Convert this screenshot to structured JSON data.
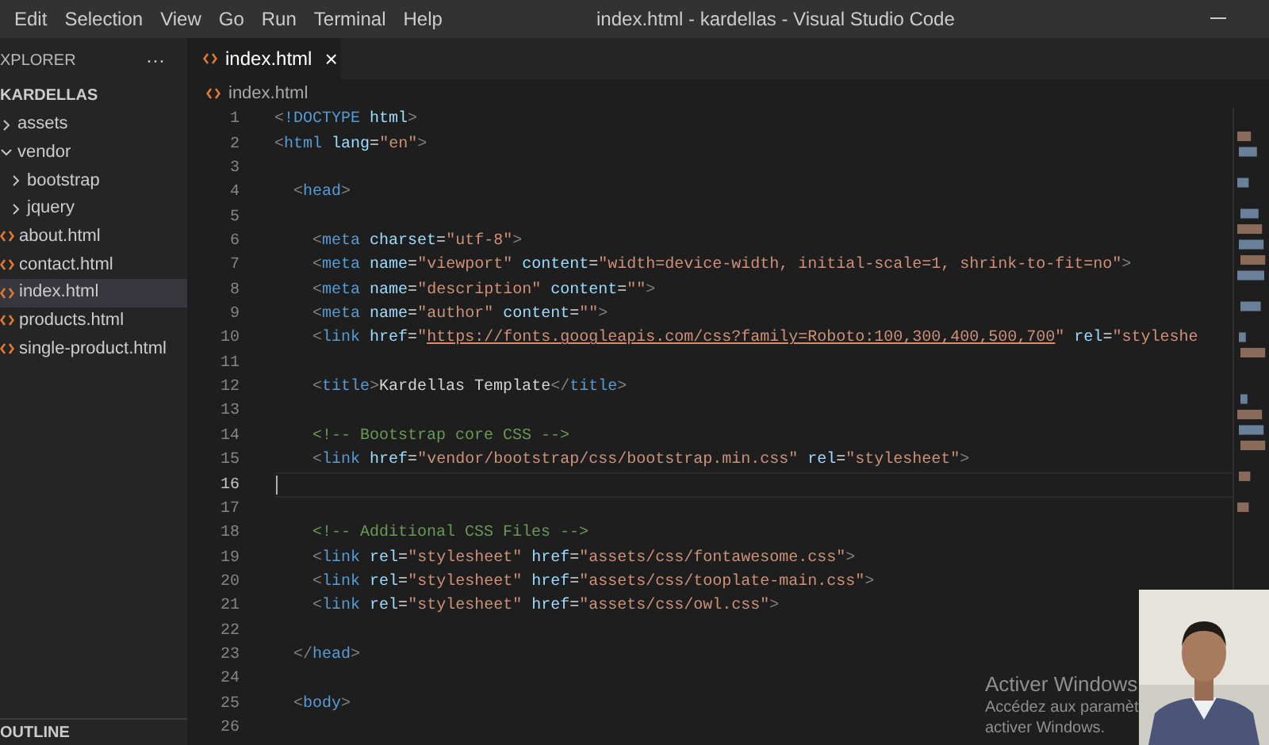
{
  "menu": [
    "Edit",
    "Selection",
    "View",
    "Go",
    "Run",
    "Terminal",
    "Help"
  ],
  "window": {
    "title": "index.html - kardellas - Visual Studio Code"
  },
  "sidebar": {
    "title": "XPLORER",
    "more": "···",
    "folder": "KARDELLAS",
    "items": [
      {
        "kind": "folder",
        "label": "assets",
        "expanded": false,
        "selected": false
      },
      {
        "kind": "folder",
        "label": "vendor",
        "expanded": true,
        "selected": false,
        "children": [
          {
            "kind": "folder",
            "label": "bootstrap",
            "expanded": false,
            "selected": false
          },
          {
            "kind": "folder",
            "label": "jquery",
            "expanded": false,
            "selected": false
          }
        ]
      },
      {
        "kind": "file",
        "label": "about.html",
        "selected": false
      },
      {
        "kind": "file",
        "label": "contact.html",
        "selected": false
      },
      {
        "kind": "file",
        "label": "index.html",
        "selected": true
      },
      {
        "kind": "file",
        "label": "products.html",
        "selected": false
      },
      {
        "kind": "file",
        "label": "single-product.html",
        "selected": false
      }
    ],
    "outline": "OUTLINE"
  },
  "tabs": [
    {
      "label": "index.html",
      "selected": true,
      "close": "×"
    }
  ],
  "breadcrumb": "index.html",
  "editor": {
    "lines": [
      {
        "number": "1",
        "current": false,
        "tokens": [
          {
            "kind": "p",
            "text": "<"
          },
          {
            "kind": "tag",
            "text": "!DOCTYPE"
          },
          {
            "kind": "attr",
            "text": " html"
          },
          {
            "kind": "p",
            "text": ">"
          }
        ]
      },
      {
        "number": "2",
        "current": false,
        "tokens": [
          {
            "kind": "p",
            "text": "<"
          },
          {
            "kind": "tag",
            "text": "html"
          },
          {
            "kind": "attr",
            "text": " lang"
          },
          {
            "kind": "text",
            "text": "="
          },
          {
            "kind": "str",
            "text": "\"en\""
          },
          {
            "kind": "p",
            "text": ">"
          }
        ]
      },
      {
        "number": "3",
        "current": false
      },
      {
        "number": "4",
        "current": false,
        "tokens": [
          {
            "kind": "p",
            "text": "  <"
          },
          {
            "kind": "tag",
            "text": "head"
          },
          {
            "kind": "p",
            "text": ">"
          }
        ]
      },
      {
        "number": "5",
        "current": false
      },
      {
        "number": "6",
        "current": false,
        "tokens": [
          {
            "kind": "p",
            "text": "    <"
          },
          {
            "kind": "tag",
            "text": "meta"
          },
          {
            "kind": "attr",
            "text": " charset"
          },
          {
            "kind": "text",
            "text": "="
          },
          {
            "kind": "str",
            "text": "\"utf-8\""
          },
          {
            "kind": "p",
            "text": ">"
          }
        ]
      },
      {
        "number": "7",
        "current": false,
        "tokens": [
          {
            "kind": "p",
            "text": "    <"
          },
          {
            "kind": "tag",
            "text": "meta"
          },
          {
            "kind": "attr",
            "text": " name"
          },
          {
            "kind": "text",
            "text": "="
          },
          {
            "kind": "str",
            "text": "\"viewport\""
          },
          {
            "kind": "attr",
            "text": " content"
          },
          {
            "kind": "text",
            "text": "="
          },
          {
            "kind": "str",
            "text": "\"width=device-width, initial-scale=1, shrink-to-fit=no\""
          },
          {
            "kind": "p",
            "text": ">"
          }
        ]
      },
      {
        "number": "8",
        "current": false,
        "tokens": [
          {
            "kind": "p",
            "text": "    <"
          },
          {
            "kind": "tag",
            "text": "meta"
          },
          {
            "kind": "attr",
            "text": " name"
          },
          {
            "kind": "text",
            "text": "="
          },
          {
            "kind": "str",
            "text": "\"description\""
          },
          {
            "kind": "attr",
            "text": " content"
          },
          {
            "kind": "text",
            "text": "="
          },
          {
            "kind": "str",
            "text": "\"\""
          },
          {
            "kind": "p",
            "text": ">"
          }
        ]
      },
      {
        "number": "9",
        "current": false,
        "tokens": [
          {
            "kind": "p",
            "text": "    <"
          },
          {
            "kind": "tag",
            "text": "meta"
          },
          {
            "kind": "attr",
            "text": " name"
          },
          {
            "kind": "text",
            "text": "="
          },
          {
            "kind": "str",
            "text": "\"author\""
          },
          {
            "kind": "attr",
            "text": " content"
          },
          {
            "kind": "text",
            "text": "="
          },
          {
            "kind": "str",
            "text": "\"\""
          },
          {
            "kind": "p",
            "text": ">"
          }
        ]
      },
      {
        "number": "10",
        "current": false,
        "tokens": [
          {
            "kind": "p",
            "text": "    <"
          },
          {
            "kind": "tag",
            "text": "link"
          },
          {
            "kind": "attr",
            "text": " href"
          },
          {
            "kind": "text",
            "text": "="
          },
          {
            "kind": "str",
            "text": "\""
          },
          {
            "kind": "url",
            "text": "https://fonts.googleapis.com/css?family=Roboto:100,300,400,500,700"
          },
          {
            "kind": "str",
            "text": "\""
          },
          {
            "kind": "attr",
            "text": " rel"
          },
          {
            "kind": "text",
            "text": "="
          },
          {
            "kind": "str",
            "text": "\"styleshe"
          }
        ]
      },
      {
        "number": "11",
        "current": false
      },
      {
        "number": "12",
        "current": false,
        "tokens": [
          {
            "kind": "p",
            "text": "    <"
          },
          {
            "kind": "tag",
            "text": "title"
          },
          {
            "kind": "p",
            "text": ">"
          },
          {
            "kind": "text",
            "text": "Kardellas Template"
          },
          {
            "kind": "p",
            "text": "</"
          },
          {
            "kind": "tag",
            "text": "title"
          },
          {
            "kind": "p",
            "text": ">"
          }
        ]
      },
      {
        "number": "13",
        "current": false
      },
      {
        "number": "14",
        "current": false,
        "tokens": [
          {
            "kind": "comment",
            "text": "    <!-- Bootstrap core CSS -->"
          }
        ]
      },
      {
        "number": "15",
        "current": false,
        "tokens": [
          {
            "kind": "p",
            "text": "    <"
          },
          {
            "kind": "tag",
            "text": "link"
          },
          {
            "kind": "attr",
            "text": " href"
          },
          {
            "kind": "text",
            "text": "="
          },
          {
            "kind": "str",
            "text": "\"vendor/bootstrap/css/bootstrap.min.css\""
          },
          {
            "kind": "attr",
            "text": " rel"
          },
          {
            "kind": "text",
            "text": "="
          },
          {
            "kind": "str",
            "text": "\"stylesheet\""
          },
          {
            "kind": "p",
            "text": ">"
          }
        ]
      },
      {
        "number": "16",
        "current": true
      },
      {
        "number": "17",
        "current": false
      },
      {
        "number": "18",
        "current": false,
        "tokens": [
          {
            "kind": "comment",
            "text": "    <!-- Additional CSS Files -->"
          }
        ]
      },
      {
        "number": "19",
        "current": false,
        "tokens": [
          {
            "kind": "p",
            "text": "    <"
          },
          {
            "kind": "tag",
            "text": "link"
          },
          {
            "kind": "attr",
            "text": " rel"
          },
          {
            "kind": "text",
            "text": "="
          },
          {
            "kind": "str",
            "text": "\"stylesheet\""
          },
          {
            "kind": "attr",
            "text": " href"
          },
          {
            "kind": "text",
            "text": "="
          },
          {
            "kind": "str",
            "text": "\"assets/css/fontawesome.css\""
          },
          {
            "kind": "p",
            "text": ">"
          }
        ]
      },
      {
        "number": "20",
        "current": false,
        "tokens": [
          {
            "kind": "p",
            "text": "    <"
          },
          {
            "kind": "tag",
            "text": "link"
          },
          {
            "kind": "attr",
            "text": " rel"
          },
          {
            "kind": "text",
            "text": "="
          },
          {
            "kind": "str",
            "text": "\"stylesheet\""
          },
          {
            "kind": "attr",
            "text": " href"
          },
          {
            "kind": "text",
            "text": "="
          },
          {
            "kind": "str",
            "text": "\"assets/css/tooplate-main.css\""
          },
          {
            "kind": "p",
            "text": ">"
          }
        ]
      },
      {
        "number": "21",
        "current": false,
        "tokens": [
          {
            "kind": "p",
            "text": "    <"
          },
          {
            "kind": "tag",
            "text": "link"
          },
          {
            "kind": "attr",
            "text": " rel"
          },
          {
            "kind": "text",
            "text": "="
          },
          {
            "kind": "str",
            "text": "\"stylesheet\""
          },
          {
            "kind": "attr",
            "text": " href"
          },
          {
            "kind": "text",
            "text": "="
          },
          {
            "kind": "str",
            "text": "\"assets/css/owl.css\""
          },
          {
            "kind": "p",
            "text": ">"
          }
        ]
      },
      {
        "number": "22",
        "current": false
      },
      {
        "number": "23",
        "current": false,
        "tokens": [
          {
            "kind": "p",
            "text": "  </"
          },
          {
            "kind": "tag",
            "text": "head"
          },
          {
            "kind": "p",
            "text": ">"
          }
        ]
      },
      {
        "number": "24",
        "current": false
      },
      {
        "number": "25",
        "current": false,
        "tokens": [
          {
            "kind": "p",
            "text": "  <"
          },
          {
            "kind": "tag",
            "text": "body"
          },
          {
            "kind": "p",
            "text": ">"
          }
        ]
      },
      {
        "number": "26",
        "current": false
      }
    ]
  },
  "activation": {
    "title": "Activer Windows",
    "line_1": "Accédez aux paramèt",
    "line_2": "activer Windows."
  }
}
